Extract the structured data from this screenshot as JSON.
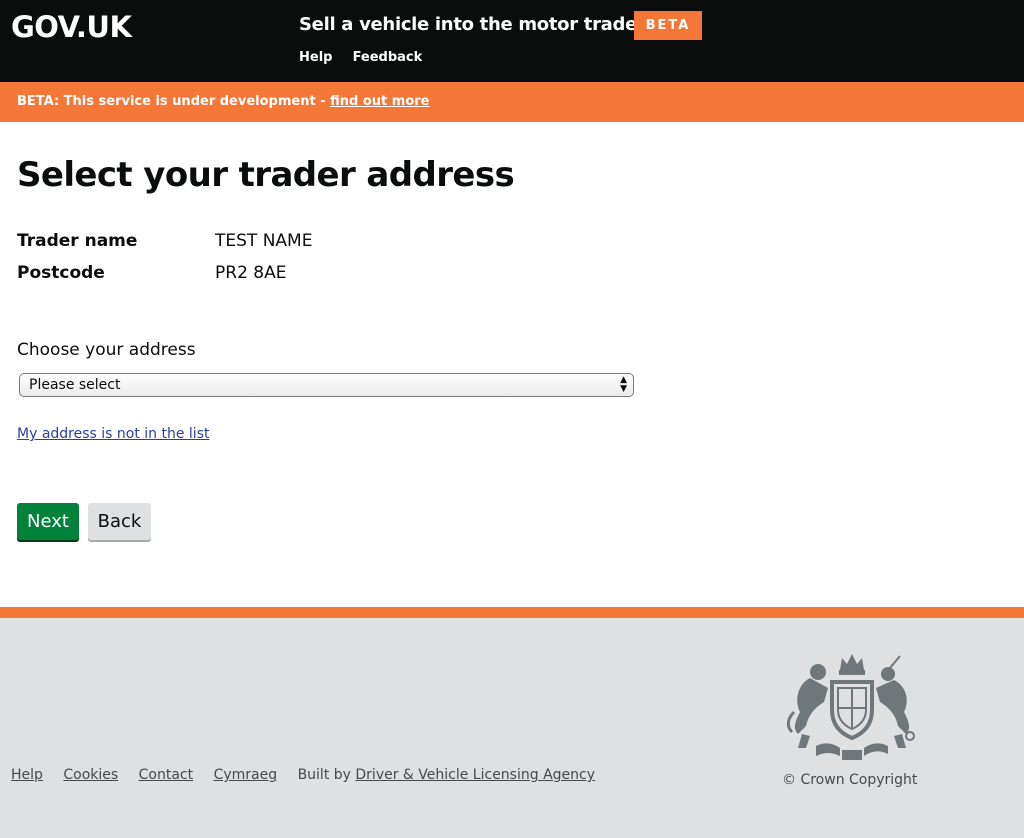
{
  "header": {
    "logo": "GOV.UK",
    "service_name": "Sell a vehicle into the motor trade",
    "beta_tag": "BETA",
    "nav": [
      "Help",
      "Feedback"
    ]
  },
  "beta_banner": {
    "text": "BETA: This service is under development - ",
    "link": "find out more"
  },
  "main": {
    "title": "Select your trader address",
    "details": [
      {
        "key": "Trader name",
        "value": "TEST NAME"
      },
      {
        "key": "Postcode",
        "value": "PR2 8AE"
      }
    ],
    "address_label": "Choose your address",
    "address_select": {
      "selected": "Please select",
      "arrows": "▲▼"
    },
    "not_listed_link": "My address is not in the list",
    "next_button": "Next",
    "back_button": "Back"
  },
  "footer": {
    "links": [
      "Help",
      "Cookies",
      "Contact",
      "Cymraeg"
    ],
    "built_by_prefix": "Built by ",
    "built_by_link": "Driver & Vehicle Licensing Agency",
    "crest_icon": "royal-coat-of-arms-icon",
    "copyright": "© Crown Copyright"
  },
  "colors": {
    "header_bg": "#0b0c0c",
    "beta_orange": "#f47738",
    "button_green": "#00823b",
    "footer_bg": "#dee0e2",
    "link_blue": "#2b3f9e"
  }
}
